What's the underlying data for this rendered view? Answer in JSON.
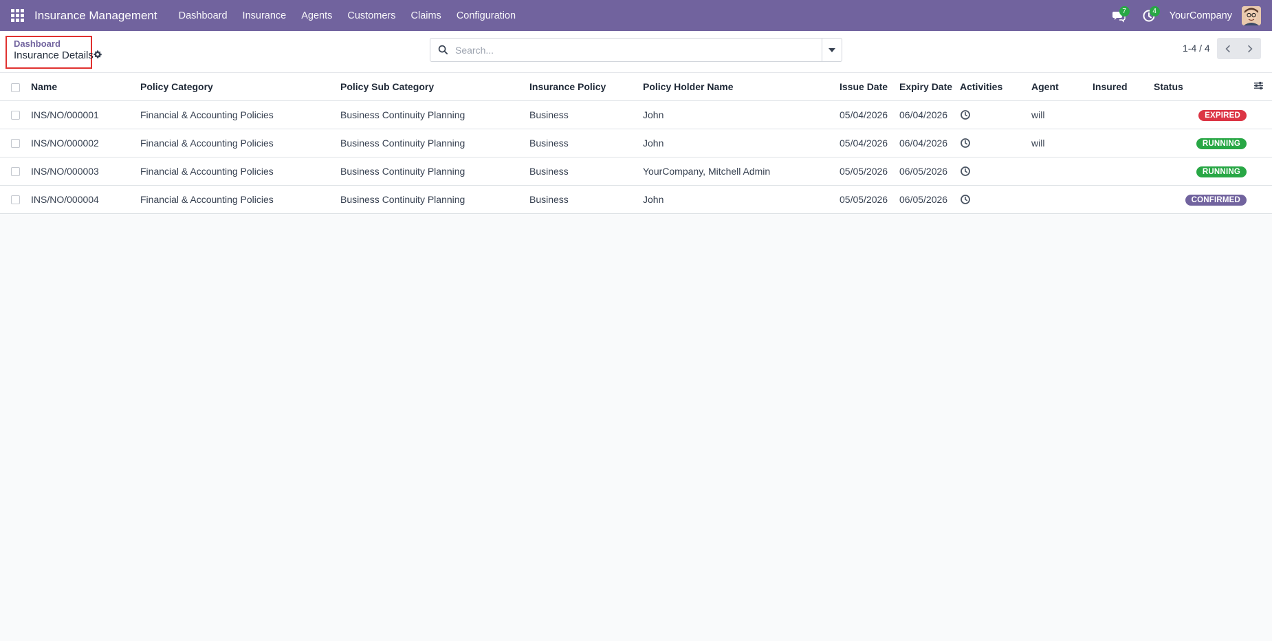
{
  "navbar": {
    "app_title": "Insurance Management",
    "menu": [
      "Dashboard",
      "Insurance",
      "Agents",
      "Customers",
      "Claims",
      "Configuration"
    ],
    "messages_count": "7",
    "activities_count": "4",
    "company": "YourCompany",
    "icons": [
      "apps-grid-icon",
      "chat-icon",
      "clock-icon",
      "avatar"
    ]
  },
  "breadcrumb": {
    "parent": "Dashboard",
    "current": "Insurance Details"
  },
  "search": {
    "placeholder": "Search...",
    "value": ""
  },
  "pager": {
    "value": "1-4 / 4"
  },
  "table": {
    "columns": [
      "Name",
      "Policy Category",
      "Policy Sub Category",
      "Insurance Policy",
      "Policy Holder Name",
      "Issue Date",
      "Expiry Date",
      "Activities",
      "Agent",
      "Insured",
      "Status"
    ],
    "rows": [
      {
        "name": "INS/NO/000001",
        "category": "Financial & Accounting Policies",
        "sub_category": "Business Continuity Planning",
        "policy": "Business",
        "holder": "John",
        "issue": "05/04/2026",
        "expiry": "06/04/2026",
        "agent": "will",
        "insured": "",
        "status": "EXPIRED",
        "status_kind": "expired"
      },
      {
        "name": "INS/NO/000002",
        "category": "Financial & Accounting Policies",
        "sub_category": "Business Continuity Planning",
        "policy": "Business",
        "holder": "John",
        "issue": "05/04/2026",
        "expiry": "06/04/2026",
        "agent": "will",
        "insured": "",
        "status": "RUNNING",
        "status_kind": "running"
      },
      {
        "name": "INS/NO/000003",
        "category": "Financial & Accounting Policies",
        "sub_category": "Business Continuity Planning",
        "policy": "Business",
        "holder": "YourCompany, Mitchell Admin",
        "issue": "05/05/2026",
        "expiry": "06/05/2026",
        "agent": "",
        "insured": "",
        "status": "RUNNING",
        "status_kind": "running"
      },
      {
        "name": "INS/NO/000004",
        "category": "Financial & Accounting Policies",
        "sub_category": "Business Continuity Planning",
        "policy": "Business",
        "holder": "John",
        "issue": "05/05/2026",
        "expiry": "06/05/2026",
        "agent": "",
        "insured": "",
        "status": "CONFIRMED",
        "status_kind": "confirmed"
      }
    ]
  },
  "colors": {
    "brand": "#71639e",
    "expired": "#dc3545",
    "running": "#28a745",
    "confirmed": "#71639e"
  }
}
